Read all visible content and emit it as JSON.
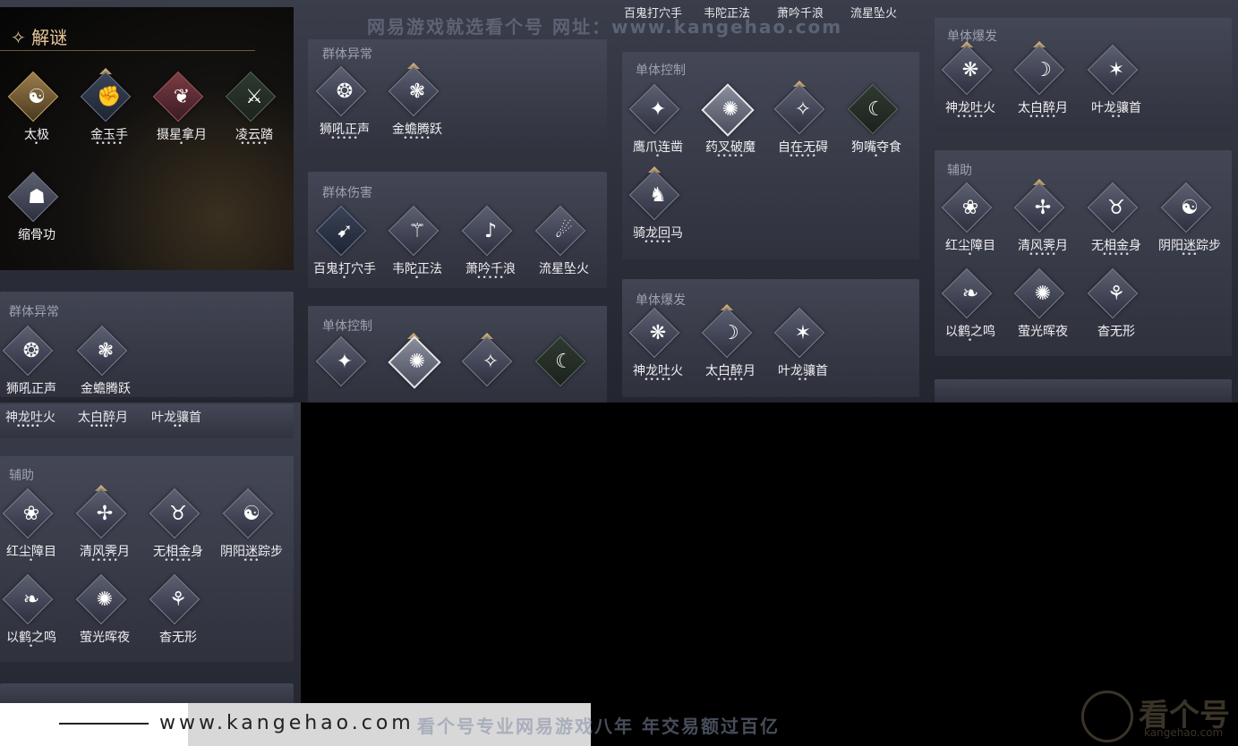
{
  "top_strip": [
    "百鬼打穴手",
    "韦陀正法",
    "萧吟千浪",
    "流星坠火"
  ],
  "watermark_top": "网易游戏就选看个号  网址：www.kangehao.com",
  "watermark_bottom": "看个号专业网易游戏八年  年交易额过百亿",
  "footer_url": "www.kangehao.com",
  "footer_logo": "看个号",
  "footer_logo_sub": "kangehao.com",
  "puzzle": {
    "title": "✧ 解谜",
    "skills": [
      {
        "name": "太极",
        "dots": "•"
      },
      {
        "name": "金玉手",
        "dots": "•••••"
      },
      {
        "name": "摄星拿月",
        "dots": "•"
      },
      {
        "name": "凌云踏",
        "dots": "•••••"
      },
      {
        "name": "缩骨功",
        "dots": ""
      }
    ]
  },
  "col2": {
    "group_abnormal": {
      "title": "群体异常",
      "skills": [
        {
          "name": "狮吼正声",
          "dots": "•••••"
        },
        {
          "name": "金蟾腾跃",
          "dots": "•••••"
        }
      ]
    },
    "group_damage": {
      "title": "群体伤害",
      "skills": [
        {
          "name": "百鬼打穴手",
          "dots": "•"
        },
        {
          "name": "韦陀正法",
          "dots": "•"
        },
        {
          "name": "萧吟千浪",
          "dots": "•••••"
        },
        {
          "name": "流星坠火",
          "dots": ""
        }
      ]
    },
    "single_control": {
      "title": "单体控制"
    }
  },
  "col3": {
    "single_control": {
      "title": "单体控制",
      "skills": [
        {
          "name": "鹰爪连凿",
          "dots": "•"
        },
        {
          "name": "药叉破魔",
          "dots": "•••••"
        },
        {
          "name": "自在无碍",
          "dots": "•••••"
        },
        {
          "name": "狗嘴夺食",
          "dots": "•"
        },
        {
          "name": "骑龙回马",
          "dots": "•••••"
        }
      ]
    },
    "single_burst": {
      "title": "单体爆发",
      "skills": [
        {
          "name": "神龙吐火",
          "dots": "•••••"
        },
        {
          "name": "太白醉月",
          "dots": "•••••"
        },
        {
          "name": "叶龙骧首",
          "dots": "••"
        }
      ]
    }
  },
  "col4": {
    "single_burst": {
      "title": "单体爆发",
      "skills": [
        {
          "name": "神龙吐火",
          "dots": "•••••"
        },
        {
          "name": "太白醉月",
          "dots": "•••••"
        },
        {
          "name": "叶龙骧首",
          "dots": "••"
        }
      ]
    },
    "support": {
      "title": "辅助",
      "skills": [
        {
          "name": "红尘障目",
          "dots": "•"
        },
        {
          "name": "清风霁月",
          "dots": "•••••"
        },
        {
          "name": "无相金身",
          "dots": "•••••"
        },
        {
          "name": "阴阳迷踪步",
          "dots": "•••"
        },
        {
          "name": "以鹤之鸣",
          "dots": "•"
        },
        {
          "name": "萤光晖夜",
          "dots": ""
        },
        {
          "name": "杳无形",
          "dots": ""
        }
      ]
    }
  },
  "left_lower": {
    "group_abnormal": {
      "title": "群体异常",
      "skills": [
        {
          "name": "狮吼正声",
          "dots": "•••••"
        },
        {
          "name": "金蟾腾跃",
          "dots": "•••••"
        }
      ]
    },
    "burst_row": [
      {
        "name": "神龙吐火",
        "dots": "•••••"
      },
      {
        "name": "太白醉月",
        "dots": "•••••"
      },
      {
        "name": "叶龙骧首",
        "dots": "••"
      }
    ],
    "support": {
      "title": "辅助",
      "skills": [
        {
          "name": "红尘障目",
          "dots": "•"
        },
        {
          "name": "清风霁月",
          "dots": "•••••"
        },
        {
          "name": "无相金身",
          "dots": "•••••"
        },
        {
          "name": "阴阳迷踪步",
          "dots": "•••"
        },
        {
          "name": "以鹤之鸣",
          "dots": "•"
        },
        {
          "name": "萤光晖夜",
          "dots": ""
        },
        {
          "name": "杳无形",
          "dots": ""
        }
      ]
    }
  }
}
